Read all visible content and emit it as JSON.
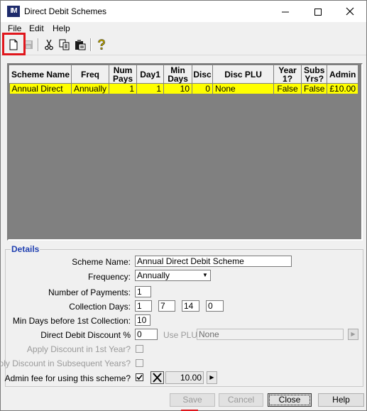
{
  "window": {
    "title": "Direct Debit Schemes",
    "app_icon_text": "IM"
  },
  "menu": {
    "file": "File",
    "edit": "Edit",
    "help": "Help"
  },
  "grid": {
    "columns": [
      "Scheme Name",
      "Freq",
      "Num Pays",
      "Day1",
      "Min Days",
      "Disc",
      "Disc PLU",
      "Year 1?",
      "Subs Yrs?",
      "Admin"
    ],
    "rows": [
      {
        "scheme_name": "Annual Direct",
        "freq": "Annually",
        "num_pays": "1",
        "day1": "1",
        "min_days": "10",
        "disc": "0",
        "disc_plu": "None",
        "year1": "False",
        "subs_yrs": "False",
        "admin": "£10.00"
      }
    ],
    "selected_row_color": "#ffff00",
    "background_color": "#808080"
  },
  "details": {
    "legend": "Details",
    "scheme_name_label": "Scheme Name:",
    "scheme_name_value": "Annual Direct Debit Scheme",
    "frequency_label": "Frequency:",
    "frequency_value": "Annually",
    "num_payments_label": "Number of Payments:",
    "num_payments_value": "1",
    "collection_days_label": "Collection Days:",
    "collection_days": [
      "1",
      "7",
      "14",
      "0"
    ],
    "min_days_label": "Min Days before 1st Collection:",
    "min_days_value": "10",
    "discount_label": "Direct Debit Discount %",
    "discount_value": "0",
    "use_plu_label": "Use PLU:",
    "use_plu_value": "None",
    "apply_first_year_label": "Apply Discount in 1st Year?",
    "apply_subsequent_label": "Apply Discount in Subsequent Years?",
    "admin_fee_label": "Admin fee for using this scheme?",
    "admin_fee_checked": true,
    "admin_fee_value": "10.00",
    "legend_color": "#1f3fb0"
  },
  "buttons": {
    "save": "Save",
    "cancel": "Cancel",
    "close": "Close",
    "help": "Help"
  },
  "highlight_color": "#e0161c"
}
